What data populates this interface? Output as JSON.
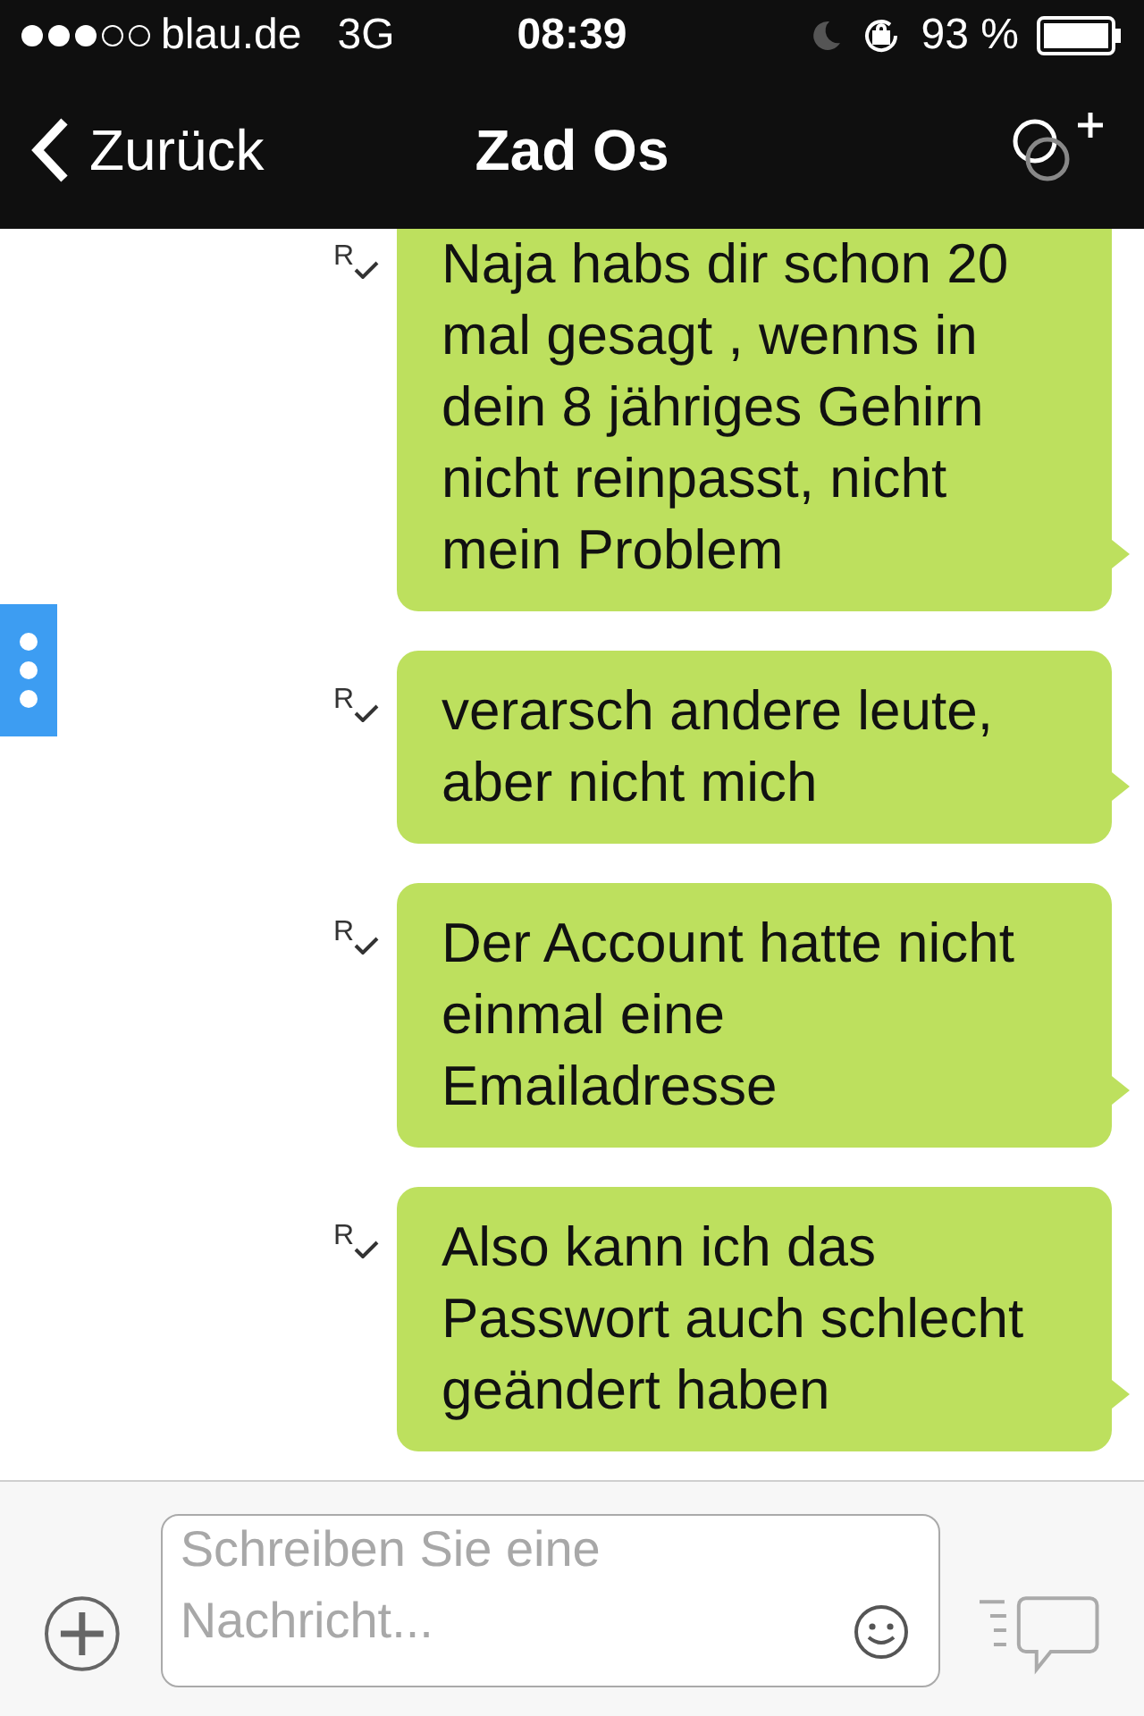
{
  "status_bar": {
    "carrier": "blau.de",
    "network": "3G",
    "time": "08:39",
    "battery": "93 %"
  },
  "nav": {
    "back": "Zurück",
    "title": "Zad Os"
  },
  "messages": [
    {
      "text": "Naja habs dir schon 20 mal gesagt , wenns in dein 8 jähriges Gehirn nicht reinpasst, nicht mein Problem",
      "receipt": "R",
      "cut_top": true
    },
    {
      "text": "verarsch andere leute, aber nicht mich",
      "receipt": "R",
      "cut_top": false
    },
    {
      "text": "Der Account hatte nicht einmal eine Emailadresse",
      "receipt": "R",
      "cut_top": false
    },
    {
      "text": "Also kann ich das Passwort auch schlecht geändert haben",
      "receipt": "R",
      "cut_top": false
    }
  ],
  "composer": {
    "placeholder": "Schreiben Sie eine Nachricht..."
  }
}
